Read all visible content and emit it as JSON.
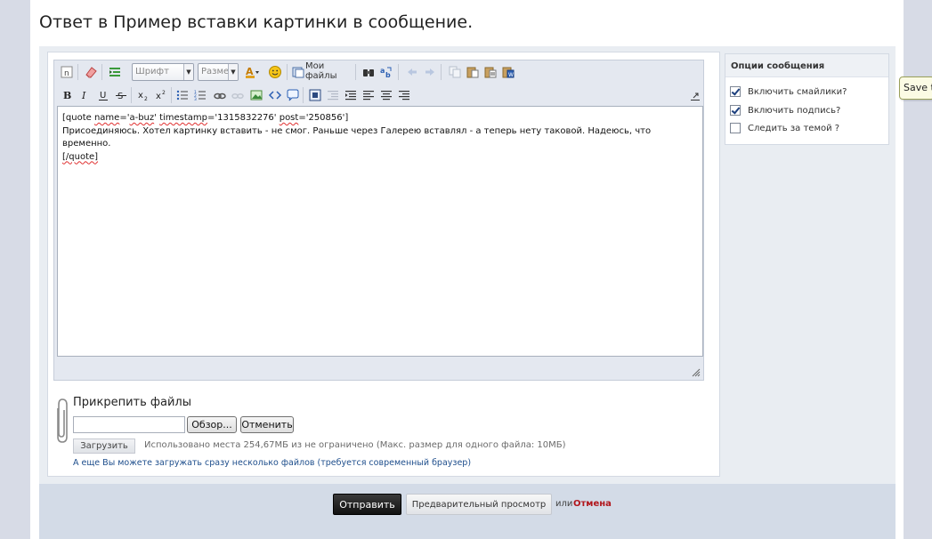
{
  "page": {
    "title": "Ответ в Пример вставки картинки в сообщение."
  },
  "toolbar": {
    "font_combo": "Шрифт",
    "size_combo": "Размер",
    "my_files": "Мои файлы"
  },
  "editor": {
    "line1_a": "[quote ",
    "line1_name": "name",
    "line1_b": "='",
    "line1_user": "a-buz",
    "line1_c": "' ",
    "line1_ts": "timestamp",
    "line1_d": "='1315832276' ",
    "line1_post": "post",
    "line1_e": "='250856']",
    "line2": "Присоединяюсь. Хотел картинку вставить - не смог. Раньше через Галерею вставлял - а теперь нету таковой. Надеюсь, что временно.",
    "line3": "[/quote]"
  },
  "attach": {
    "title": "Прикрепить файлы",
    "browse": "Обзор...",
    "cancel": "Отменить",
    "upload": "Загрузить",
    "usage": "Использовано места 254,67МБ из не ограничено (Макс. размер для одного файла: 10МБ)",
    "multi_link": "А еще Вы можете загружать сразу несколько файлов (требуется современный браузер)"
  },
  "options": {
    "title": "Опции сообщения",
    "items": [
      {
        "label": "Включить смайлики?",
        "checked": true
      },
      {
        "label": "Включить подпись?",
        "checked": true
      },
      {
        "label": "Следить за темой ?",
        "checked": false
      }
    ]
  },
  "footer": {
    "submit": "Отправить",
    "preview": "Предварительный просмотр",
    "or": "или",
    "cancel": "Отмена"
  },
  "tooltip": {
    "text": "Save to"
  },
  "colors": {
    "accent_dark": "#111111",
    "cancel_red": "#b1161c",
    "link_blue": "#1e4e8c"
  }
}
